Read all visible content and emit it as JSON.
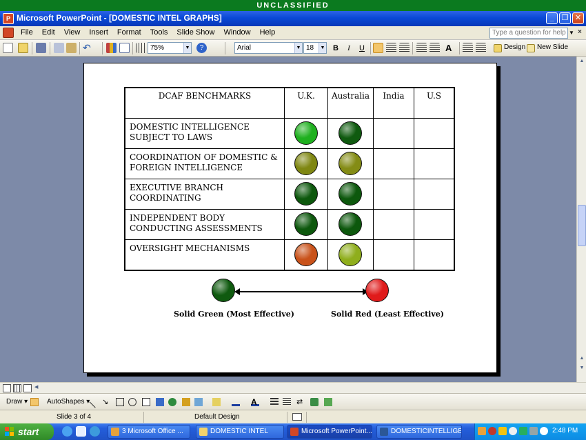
{
  "banner": "UNCLASSIFIED",
  "window": {
    "title": "Microsoft PowerPoint - [DOMESTIC INTEL GRAPHS]"
  },
  "menu": [
    "File",
    "Edit",
    "View",
    "Insert",
    "Format",
    "Tools",
    "Slide Show",
    "Window",
    "Help"
  ],
  "help_placeholder": "Type a question for help",
  "toolbar": {
    "zoom": "75%",
    "font": "Arial",
    "font_size": "18",
    "bold": "B",
    "italic": "I",
    "underline": "U",
    "design_label": "Design",
    "new_slide_label": "New Slide"
  },
  "slide": {
    "headers": [
      "DCAF BENCHMARKS",
      "U.K.",
      "Australia",
      "India",
      "U.S"
    ],
    "rows": [
      {
        "label": "DOMESTIC INTELLIGENCE SUBJECT TO LAWS",
        "uk": "#1fb01f",
        "australia": "#0f5a0f"
      },
      {
        "label": "COORDINATION OF DOMESTIC & FOREIGN INTELLIGENCE",
        "uk": "#7f8712",
        "australia": "#848c15"
      },
      {
        "label": "EXECUTIVE BRANCH COORDINATING",
        "uk": "#0d580d",
        "australia": "#0d580d"
      },
      {
        "label": "INDEPENDENT BODY CONDUCTING ASSESSMENTS",
        "uk": "#0d580d",
        "australia": "#0d580d"
      },
      {
        "label": "OVERSIGHT MECHANISMS",
        "uk": "#c9521a",
        "australia": "#8fae1c"
      }
    ],
    "legend": {
      "left_label": "Solid Green (Most Effective)",
      "right_label": "Solid Red (Least Effective)",
      "left_color": "#0f5a0f",
      "right_color": "#e01b1b"
    }
  },
  "drawbar": {
    "draw_label": "Draw",
    "autoshapes_label": "AutoShapes"
  },
  "status": {
    "slide": "Slide 3 of 4",
    "design": "Default Design"
  },
  "taskbar": {
    "start": "start",
    "tasks": [
      "3 Microsoft Office ...",
      "DOMESTIC INTEL",
      "Microsoft PowerPoint...",
      "DOMESTICINTELLIGE..."
    ],
    "clock": "2:48 PM"
  }
}
